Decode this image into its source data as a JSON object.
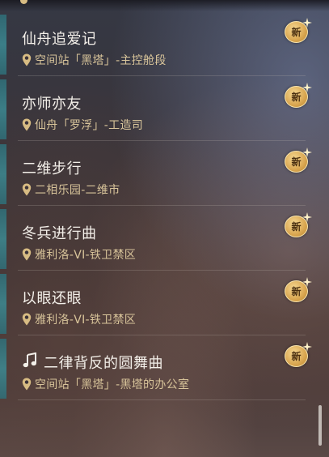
{
  "quests": [
    {
      "title": "仙舟追爱记",
      "location": "空间站「黑塔」-主控舱段",
      "badge": "新",
      "has_icon": false
    },
    {
      "title": "亦师亦友",
      "location": "仙舟「罗浮」-工造司",
      "badge": "新",
      "has_icon": false
    },
    {
      "title": "二维步行",
      "location": "二相乐园-二维市",
      "badge": "新",
      "has_icon": false
    },
    {
      "title": "冬兵进行曲",
      "location": "雅利洛-VI-铁卫禁区",
      "badge": "新",
      "has_icon": false
    },
    {
      "title": "以眼还眼",
      "location": "雅利洛-VI-铁卫禁区",
      "badge": "新",
      "has_icon": false
    },
    {
      "title": "二律背反的圆舞曲",
      "location": "空间站「黑塔」-黑塔的办公室",
      "badge": "新",
      "has_icon": true,
      "icon": "music-note-icon"
    }
  ],
  "colors": {
    "title": "#f3efe9",
    "location": "#d8c49a",
    "badge_gold": "#d9a650",
    "accent_teal": "#3c8a93"
  }
}
